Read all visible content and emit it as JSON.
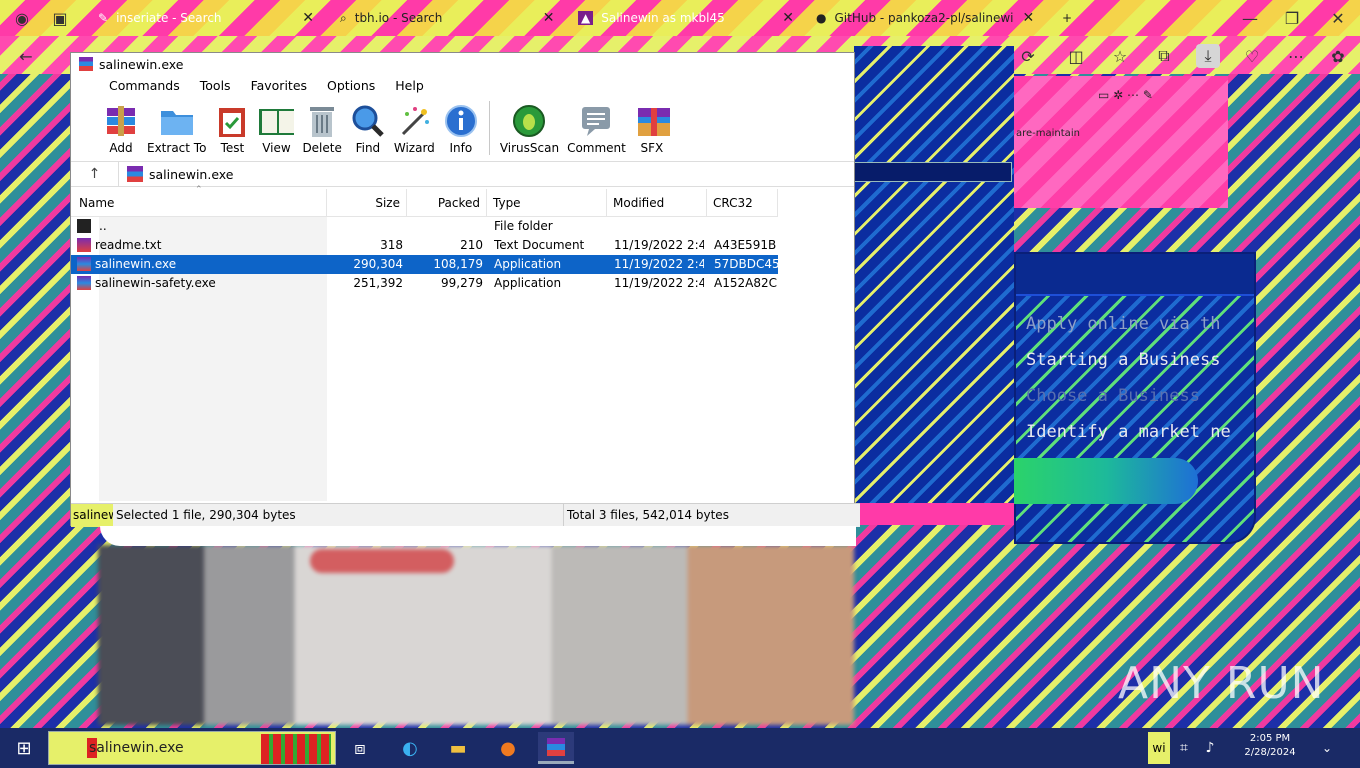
{
  "browser": {
    "tabs": [
      {
        "title": "inseriate - Search",
        "close": "✕"
      },
      {
        "title": "tbh.io - Search",
        "close": "✕"
      },
      {
        "title": "Salinewin as mkbl45",
        "close": "✕"
      },
      {
        "title": "GitHub - pankoza2-pl/salinewin",
        "close": "✕"
      }
    ],
    "new_tab": "+"
  },
  "background_page": {
    "pink_caption": "are-maintain",
    "panel_lines": [
      "Apply online via th",
      "Starting a Business",
      "Choose a Business",
      "Identify a market ne"
    ]
  },
  "winrar": {
    "title": "salinewin.exe",
    "menu": [
      "Commands",
      "Tools",
      "Favorites",
      "Options",
      "Help"
    ],
    "toolbar": [
      {
        "label": "Add",
        "icon": "add-archive-icon"
      },
      {
        "label": "Extract To",
        "icon": "extract-folder-icon"
      },
      {
        "label": "Test",
        "icon": "test-clipboard-icon"
      },
      {
        "label": "View",
        "icon": "view-book-icon"
      },
      {
        "label": "Delete",
        "icon": "delete-trash-icon"
      },
      {
        "label": "Find",
        "icon": "find-magnifier-icon"
      },
      {
        "label": "Wizard",
        "icon": "wizard-wand-icon"
      },
      {
        "label": "Info",
        "icon": "info-icon"
      },
      {
        "label": "VirusScan",
        "icon": "virusscan-bug-icon"
      },
      {
        "label": "Comment",
        "icon": "comment-icon"
      },
      {
        "label": "SFX",
        "icon": "sfx-box-icon"
      }
    ],
    "address": "salinewin.exe",
    "columns": [
      "Name",
      "Size",
      "Packed",
      "Type",
      "Modified",
      "CRC32"
    ],
    "rows": [
      {
        "name": "..",
        "size": "",
        "packed": "",
        "type": "File folder",
        "modified": "",
        "crc": "",
        "selected": false
      },
      {
        "name": "readme.txt",
        "size": "318",
        "packed": "210",
        "type": "Text Document",
        "modified": "11/19/2022 2:4...",
        "crc": "A43E591B",
        "selected": false
      },
      {
        "name": "salinewin.exe",
        "size": "290,304",
        "packed": "108,179",
        "type": "Application",
        "modified": "11/19/2022 2:4...",
        "crc": "57DBDC45",
        "selected": true
      },
      {
        "name": "salinewin-safety.exe",
        "size": "251,392",
        "packed": "99,279",
        "type": "Application",
        "modified": "11/19/2022 2:4...",
        "crc": "A152A82C",
        "selected": false
      }
    ],
    "status_left_tag": "salinew",
    "status_selected": "Selected 1 file, 290,304 bytes",
    "status_total": "Total 3 files, 542,014 bytes"
  },
  "taskbar": {
    "search_text": "salinewin.exe",
    "time": "2:05 PM",
    "date": "2/28/2024",
    "tray_label": "wi"
  },
  "watermark": "ANY RUN",
  "colors": {
    "selection": "#0d64c8",
    "taskbar": "#1a2a66"
  }
}
